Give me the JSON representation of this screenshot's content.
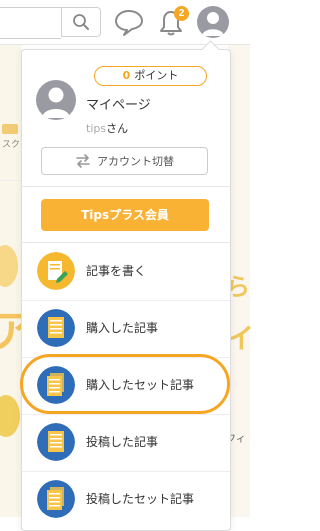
{
  "header": {
    "notification_count": "2",
    "icons": {
      "search": "search-icon",
      "chat": "chat-icon",
      "bell": "bell-icon",
      "avatar": "avatar-icon"
    }
  },
  "background": {
    "left_label": "スク",
    "right_text1": "ら",
    "right_text2": "イ",
    "right_small": "フィ",
    "left_big": "ア"
  },
  "dropdown": {
    "points_value": "0",
    "points_label": "ポイント",
    "mypage_label": "マイページ",
    "user_id": "tips",
    "user_suffix": "さん",
    "switch_account_label": "アカウント切替",
    "tips_plus_label": "Tipsプラス会員",
    "menu": [
      {
        "label": "記事を書く",
        "icon": "write-article-icon"
      },
      {
        "label": "購入した記事",
        "icon": "purchased-article-icon"
      },
      {
        "label": "購入したセット記事",
        "icon": "purchased-set-article-icon"
      },
      {
        "label": "投稿した記事",
        "icon": "posted-article-icon"
      },
      {
        "label": "投稿したセット記事",
        "icon": "posted-set-article-icon"
      }
    ]
  },
  "colors": {
    "accent": "#f5a623",
    "tips_plus_bg": "#f9b233",
    "menu_icon_blue": "#2f6db8",
    "menu_icon_yellow": "#f5b82e"
  }
}
